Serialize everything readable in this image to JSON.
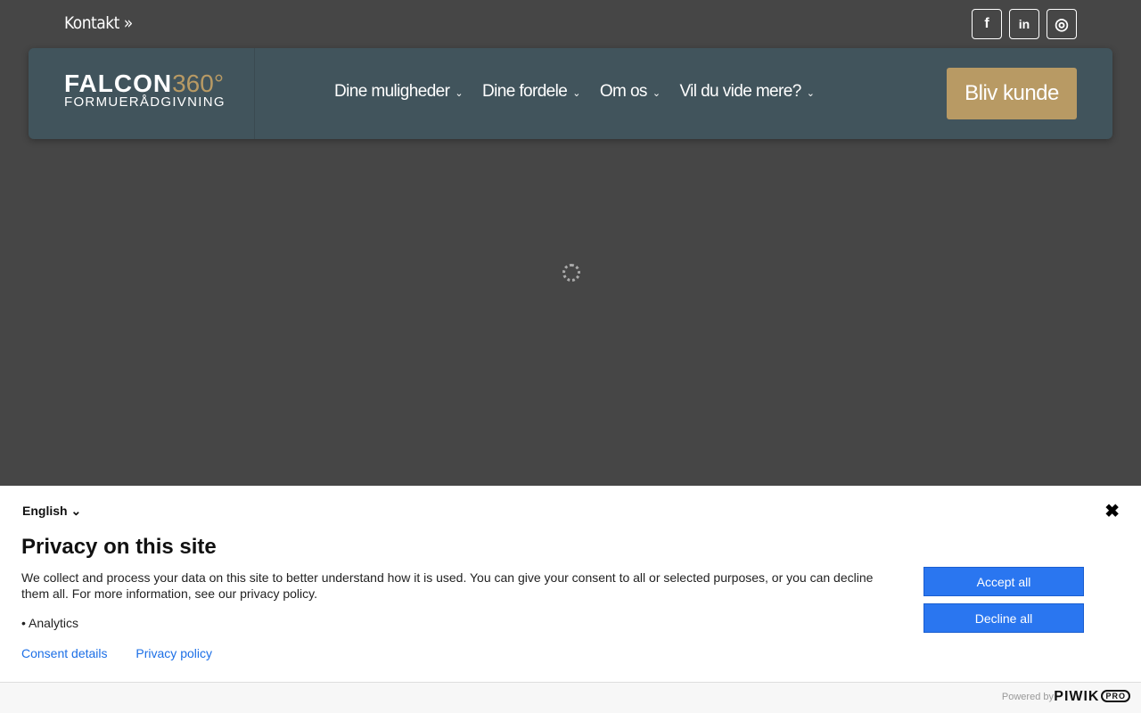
{
  "topbar": {
    "kontakt": "Kontakt »",
    "social": [
      {
        "icon": "facebook-icon",
        "glyph": "f"
      },
      {
        "icon": "linkedin-icon",
        "glyph": "in"
      },
      {
        "icon": "instagram-icon",
        "glyph": "◎"
      }
    ]
  },
  "nav": {
    "logo_main": "FALCON",
    "logo_num": "360°",
    "logo_sub": "FORMUERÅDGIVNING",
    "items": [
      "Dine muligheder",
      "Dine fordele",
      "Om os",
      "Vil du vide mere?"
    ],
    "cta": "Bliv kunde"
  },
  "consent": {
    "language": "English ⌄",
    "close": "✖",
    "title": "Privacy on this site",
    "description": "We collect and process your data on this site to better understand how it is used. You can give your consent to all or selected purposes, or you can decline them all. For more information, see our privacy policy.",
    "purpose": "• Analytics",
    "consent_details": "Consent details",
    "privacy_policy": "Privacy policy",
    "accept": "Accept all",
    "decline": "Decline all",
    "powered_by": "Powered by",
    "brand": "PIWIK",
    "brand_badge": "PRO"
  }
}
